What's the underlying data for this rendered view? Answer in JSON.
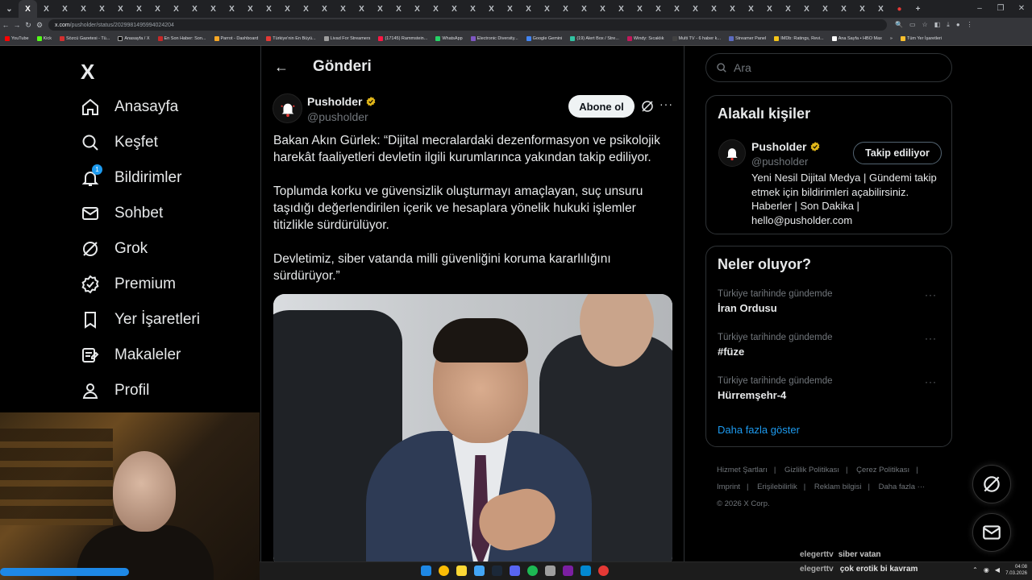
{
  "browser": {
    "tab_label": "X",
    "url_host": "x.com",
    "url_path": "/pusholder/status/2029981495994024204",
    "bookmarks": [
      "YouTube",
      "Kick",
      "Sözcü Gazetesi - Tü...",
      "Anasayfa / X",
      "En Son Haber: Son...",
      "Parrot - Dashboard",
      "Türkiye'nin En Büyü...",
      "Livad For Streamers",
      "(17145) Rammstein...",
      "WhatsApp",
      "Electronic Diversity...",
      "Google Gemini",
      "(19) Alert Box / Stre...",
      "Windy: Sıcaklık",
      "Multi TV - 6 haber k...",
      "Streamer Panel",
      "IMDb: Ratings, Revi...",
      "Ana Sayfa • HBO Max",
      "»",
      "Tüm Yer İşaretleri"
    ]
  },
  "sidebar": {
    "logo": "X",
    "items": [
      {
        "label": "Anasayfa",
        "icon": "home-icon"
      },
      {
        "label": "Keşfet",
        "icon": "search-icon"
      },
      {
        "label": "Bildirimler",
        "icon": "bell-icon",
        "badge": "1"
      },
      {
        "label": "Sohbet",
        "icon": "mail-icon"
      },
      {
        "label": "Grok",
        "icon": "grok-icon"
      },
      {
        "label": "Premium",
        "icon": "verified-icon"
      },
      {
        "label": "Yer İşaretleri",
        "icon": "bookmark-icon"
      },
      {
        "label": "Makaleler",
        "icon": "article-icon"
      },
      {
        "label": "Profil",
        "icon": "profile-icon"
      }
    ]
  },
  "post": {
    "header_title": "Gönderi",
    "author_name": "Pusholder",
    "author_handle": "@pusholder",
    "follow_label": "Abone ol",
    "paragraphs": [
      "Bakan Akın Gürlek: “Dijital mecralardaki dezenformasyon ve psikolojik harekât faaliyetleri devletin ilgili kurumlarınca yakından takip ediliyor.",
      "Toplumda korku ve güvensizlik oluşturmayı amaçlayan, suç unsuru taşıdığı değerlendirilen içerik ve hesaplara yönelik hukuki işlemler titizlikle sürdürülüyor.",
      "Devletimiz, siber vatanda milli güvenliğini koruma kararlılığını sürdürüyor.”"
    ]
  },
  "right": {
    "search_placeholder": "Ara",
    "related_title": "Alakalı kişiler",
    "related": {
      "name": "Pusholder",
      "handle": "@pusholder",
      "button": "Takip ediliyor",
      "bio": "Yeni Nesil Dijital Medya | Gündemi takip etmek için bildirimleri açabilirsiniz. Haberler | Son Dakika | hello@pusholder.com"
    },
    "trends_title": "Neler oluyor?",
    "trends": [
      {
        "context": "Türkiye tarihinde gündemde",
        "topic": "İran Ordusu"
      },
      {
        "context": "Türkiye tarihinde gündemde",
        "topic": "#füze"
      },
      {
        "context": "Türkiye tarihinde gündemde",
        "topic": "Hürremşehr-4"
      }
    ],
    "show_more": "Daha fazla göster",
    "footer_links": [
      "Hizmet Şartları",
      "|",
      "Gizlilik Politikası",
      "|",
      "Çerez Politikası",
      "|",
      "Imprint",
      "|",
      "Erişilebilirlik",
      "|",
      "Reklam bilgisi",
      "|",
      "Daha fazla ···"
    ],
    "copyright": "© 2026 X Corp."
  },
  "stream_overlay": {
    "line1_user": "elegerttv",
    "line1_msg": "siber vatan",
    "line2_user": "elegerttv",
    "line2_msg": "çok erotik bi kavram"
  },
  "taskbar": {
    "time": "04:08",
    "date": "7.03.2026"
  }
}
